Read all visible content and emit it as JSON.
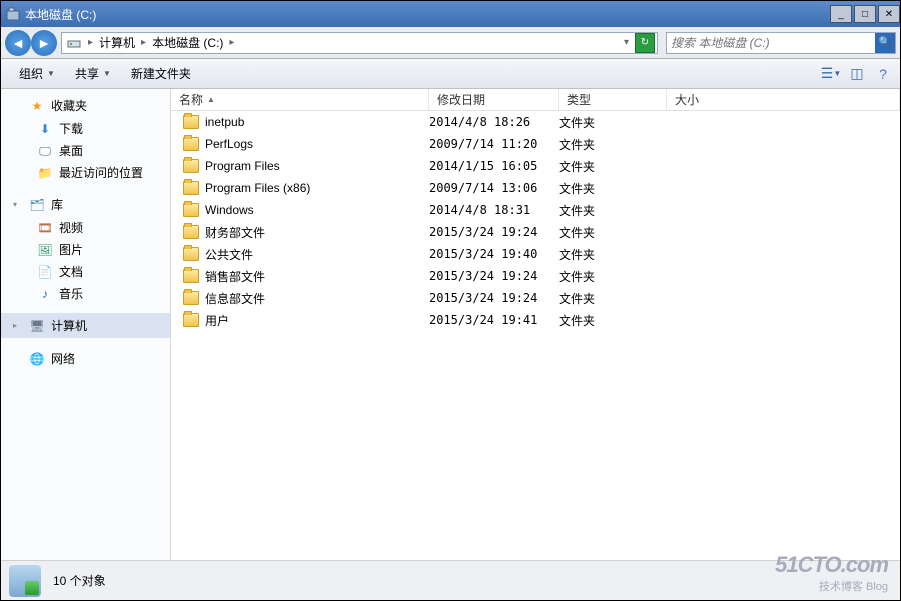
{
  "window": {
    "title": "本地磁盘 (C:)"
  },
  "address": {
    "items": [
      "计算机",
      "本地磁盘 (C:)"
    ]
  },
  "search": {
    "placeholder": "搜索 本地磁盘 (C:)"
  },
  "toolbar": {
    "organize": "组织",
    "share": "共享",
    "newfolder": "新建文件夹"
  },
  "sidebar": {
    "favorites": {
      "label": "收藏夹",
      "items": [
        "下载",
        "桌面",
        "最近访问的位置"
      ]
    },
    "libraries": {
      "label": "库",
      "items": [
        "视频",
        "图片",
        "文档",
        "音乐"
      ]
    },
    "computer": {
      "label": "计算机"
    },
    "network": {
      "label": "网络"
    }
  },
  "columns": {
    "name": "名称",
    "date": "修改日期",
    "type": "类型",
    "size": "大小"
  },
  "files": [
    {
      "name": "inetpub",
      "date": "2014/4/8 18:26",
      "type": "文件夹"
    },
    {
      "name": "PerfLogs",
      "date": "2009/7/14 11:20",
      "type": "文件夹"
    },
    {
      "name": "Program Files",
      "date": "2014/1/15 16:05",
      "type": "文件夹"
    },
    {
      "name": "Program Files (x86)",
      "date": "2009/7/14 13:06",
      "type": "文件夹"
    },
    {
      "name": "Windows",
      "date": "2014/4/8 18:31",
      "type": "文件夹"
    },
    {
      "name": "财务部文件",
      "date": "2015/3/24 19:24",
      "type": "文件夹"
    },
    {
      "name": "公共文件",
      "date": "2015/3/24 19:40",
      "type": "文件夹"
    },
    {
      "name": "销售部文件",
      "date": "2015/3/24 19:24",
      "type": "文件夹"
    },
    {
      "name": "信息部文件",
      "date": "2015/3/24 19:24",
      "type": "文件夹"
    },
    {
      "name": "用户",
      "date": "2015/3/24 19:41",
      "type": "文件夹"
    }
  ],
  "status": {
    "count_text": "10 个对象"
  },
  "watermark": {
    "big": "51CTO.com",
    "small": "技术博客   Blog"
  }
}
